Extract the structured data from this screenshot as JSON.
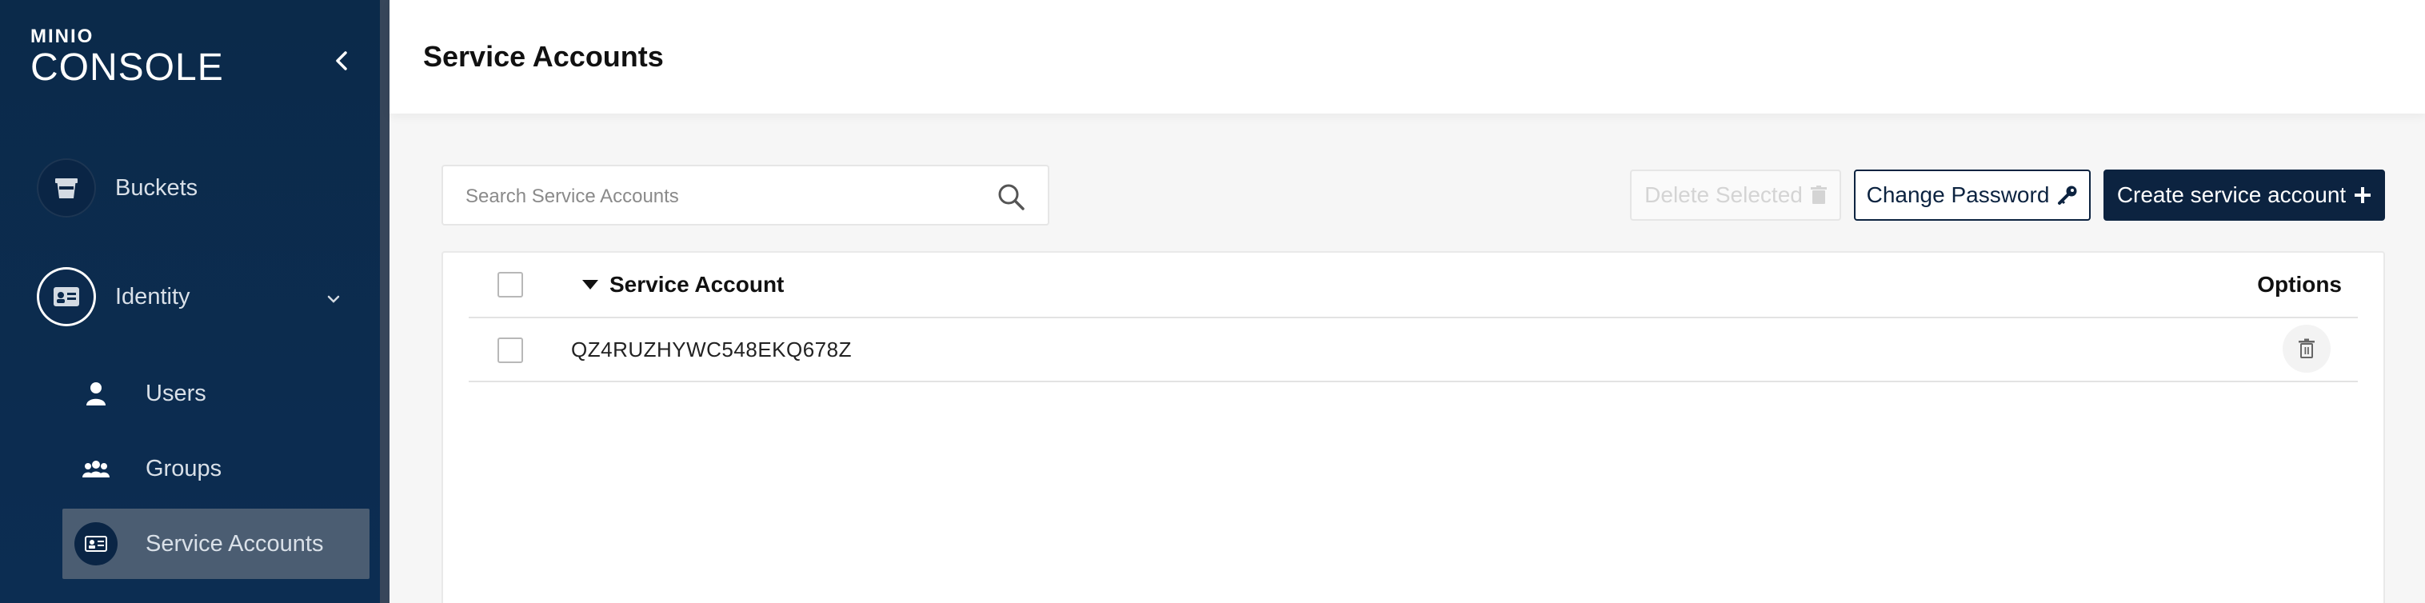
{
  "brand": {
    "top": "MINIO",
    "main": "CONSOLE"
  },
  "sidebar": {
    "items": [
      {
        "label": "Buckets"
      },
      {
        "label": "Identity"
      }
    ],
    "identity_sub": [
      {
        "label": "Users"
      },
      {
        "label": "Groups"
      },
      {
        "label": "Service Accounts"
      }
    ]
  },
  "header": {
    "title": "Service Accounts"
  },
  "toolbar": {
    "search_placeholder": "Search Service Accounts",
    "delete_selected_label": "Delete Selected",
    "change_password_label": "Change Password",
    "create_label": "Create service account"
  },
  "table": {
    "columns": {
      "account": "Service Account",
      "options": "Options"
    },
    "rows": [
      {
        "account": "QZ4RUZHYWC548EKQ678Z"
      }
    ]
  },
  "colors": {
    "sidebar_bg": "#0c2d52",
    "primary": "#0c2340",
    "active_nav": "#4b5d72"
  }
}
